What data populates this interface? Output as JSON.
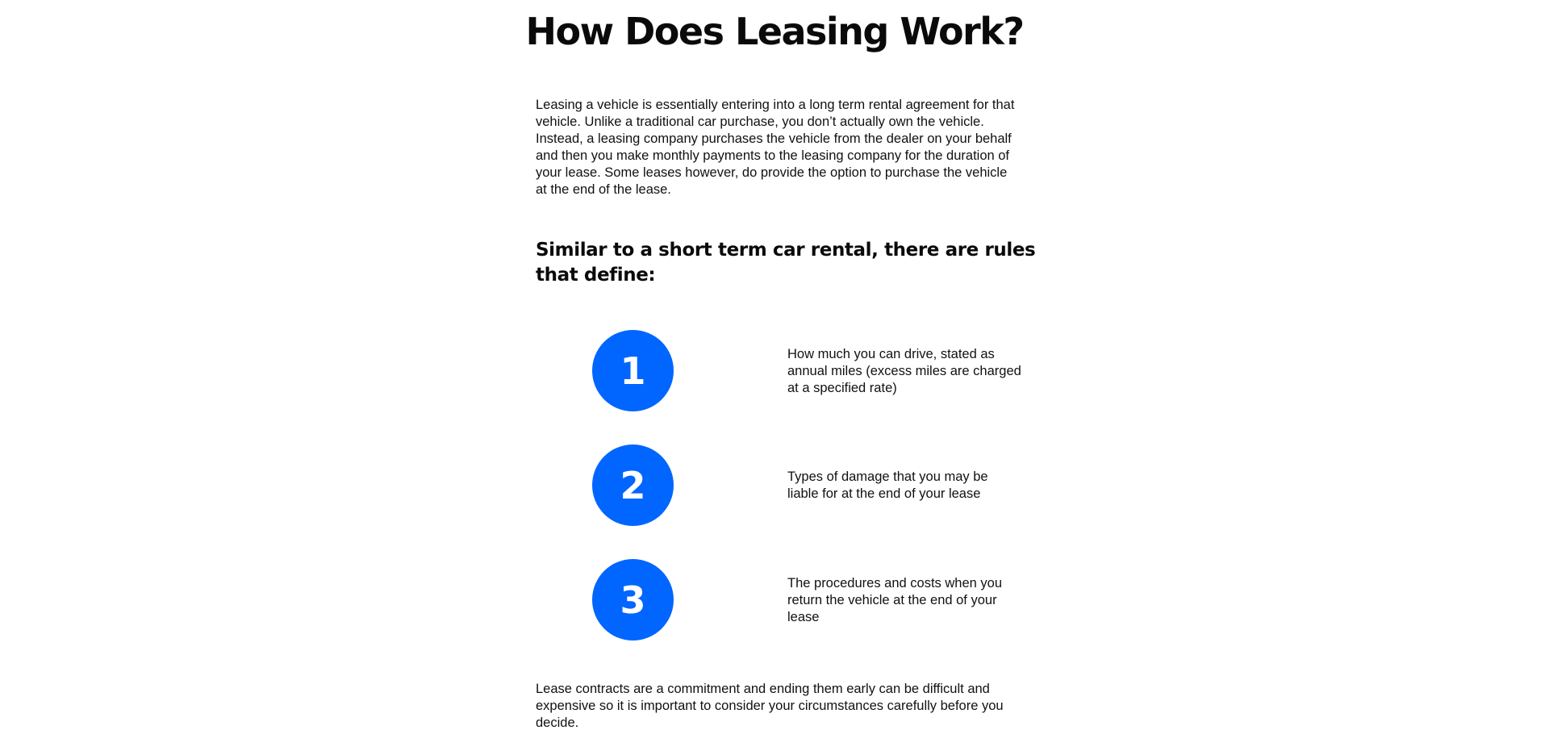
{
  "title": "How Does Leasing Work?",
  "intro": "Leasing a vehicle is essentially entering into a long term rental agreement for that vehicle. Unlike a traditional car purchase, you don’t actually own the vehicle. Instead, a leasing company purchases the vehicle from the dealer on your behalf and then you make monthly payments to the leasing company for the duration of your lease. Some leases however, do provide the option to purchase the vehicle at the end of the lease.",
  "subheading": "Similar to a short term car rental, there are rules that define:",
  "rules": [
    {
      "number": "1",
      "text": "How much you can drive, stated as annual miles (excess miles are charged at a specified rate)"
    },
    {
      "number": "2",
      "text": "Types of damage that you may be liable for at the end of your lease"
    },
    {
      "number": "3",
      "text": "The procedures and costs when you return the vehicle at the end of your lease"
    }
  ],
  "closing": "Lease contracts are a commitment and ending them early can be difficult and expensive so it is important to consider your circumstances carefully before you decide.",
  "colors": {
    "accent": "#0066ff",
    "text": "#111111",
    "background": "#ffffff"
  }
}
